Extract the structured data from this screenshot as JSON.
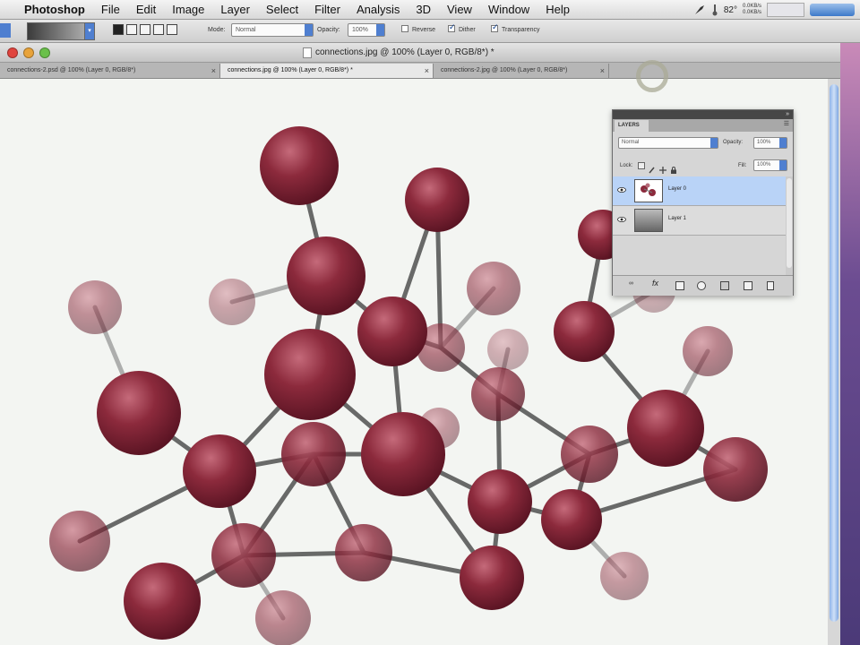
{
  "menubar": {
    "items": [
      "Photoshop",
      "File",
      "Edit",
      "Image",
      "Layer",
      "Select",
      "Filter",
      "Analysis",
      "3D",
      "View",
      "Window",
      "Help"
    ],
    "status": {
      "temperature": "82°",
      "speed_line1": "0.0KB/s",
      "speed_line2": "0.0KB/s"
    }
  },
  "options_bar": {
    "mode_label": "Mode:",
    "mode_value": "Normal",
    "opacity_label": "Opacity:",
    "opacity_value": "100%",
    "reverse_label": "Reverse",
    "reverse_checked": false,
    "dither_label": "Dither",
    "dither_checked": true,
    "transparency_label": "Transparency",
    "transparency_checked": true
  },
  "window": {
    "title": "connections.jpg @ 100% (Layer 0, RGB/8*) *"
  },
  "tabs": [
    {
      "label": "connections-2.psd @ 100% (Layer 0, RGB/8*)",
      "active": false
    },
    {
      "label": "connections.jpg @ 100% (Layer 0, RGB/8*) *",
      "active": true
    },
    {
      "label": "connections-2.jpg @ 100% (Layer 0, RGB/8*)",
      "active": false
    }
  ],
  "layers_panel": {
    "tab_label": "LAYERS",
    "blend_mode": "Normal",
    "opacity_label": "Opacity:",
    "opacity_value": "100%",
    "lock_label": "Lock:",
    "fill_label": "Fill:",
    "fill_value": "100%",
    "layers": [
      {
        "name": "Layer 0",
        "selected": true,
        "visible": true
      },
      {
        "name": "Layer 1",
        "selected": false,
        "visible": true
      }
    ]
  },
  "colors": {
    "atom": "#8c2a3c",
    "bond": "#5a5a5a",
    "canvas": "#f3f5f2",
    "accent": "#4f7fd0"
  }
}
